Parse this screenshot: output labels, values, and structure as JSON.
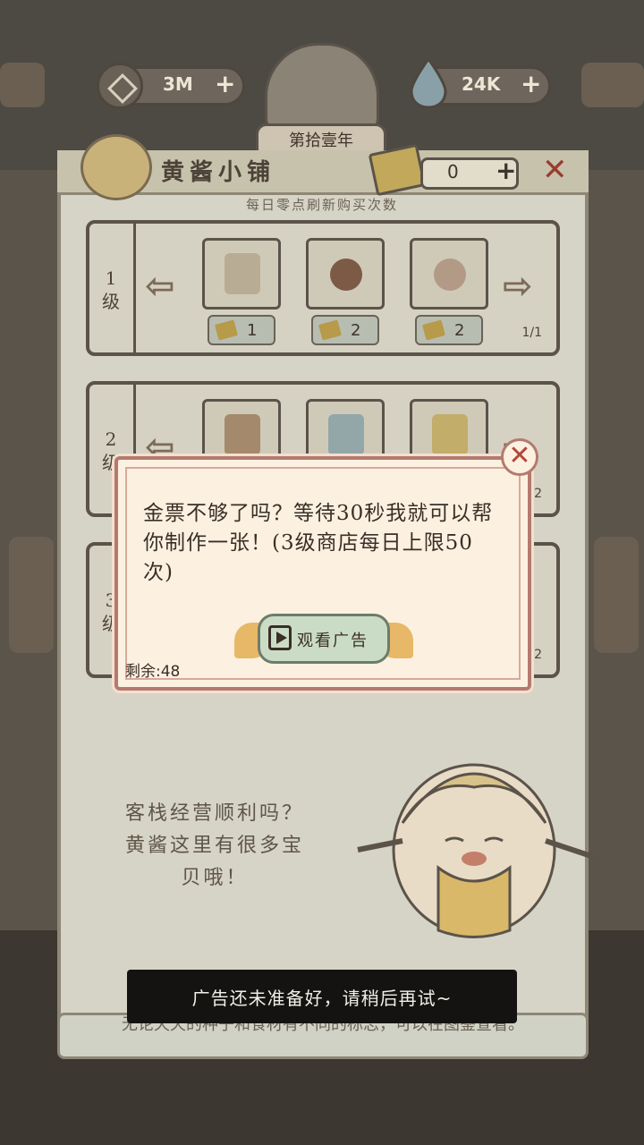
{
  "resources": {
    "coins": "3M",
    "spirit": "24K",
    "plus": "+"
  },
  "year_label": "第拾壹年",
  "shop": {
    "title": "黄酱小铺",
    "ticket_count": "0",
    "ticket_plus": "+",
    "close": "✕",
    "refresh_note": "每日零点刷新购买次数",
    "tiers": [
      {
        "label": "1级",
        "items": [
          {
            "icon": "seed-pack-icon",
            "price": "1"
          },
          {
            "icon": "dumpling-plate-icon",
            "price": "2"
          },
          {
            "icon": "steamed-bun-icon",
            "price": "2"
          }
        ],
        "page": "1/1"
      },
      {
        "label": "2级",
        "items": [
          {
            "icon": "lantern-stack-icon",
            "price": ""
          },
          {
            "icon": "spirit-wisp-icon",
            "price": ""
          },
          {
            "icon": "golden-pack-icon",
            "price": ""
          }
        ],
        "page": "2"
      },
      {
        "label": "3级",
        "items": [],
        "page": "2"
      }
    ],
    "mascot_speech": "客栈经营顺利吗？黄酱这里有很多宝贝哦！",
    "bottom_tip": "无论天天的种子和食材有不同的标志，可以在图鉴查看。"
  },
  "dialog": {
    "message": "金票不够了吗？等待30秒我就可以帮你制作一张！(3级商店每日上限50次)",
    "close": "✕",
    "watch_ad": "观看广告",
    "remaining": "剩余:48"
  },
  "toast": "广告还未准备好，请稍后再试~",
  "colors": {
    "dialog_bg": "#fcf1e1",
    "dialog_border": "#b47a6f",
    "close_red": "#b5453a",
    "toast_bg": "#141311"
  }
}
